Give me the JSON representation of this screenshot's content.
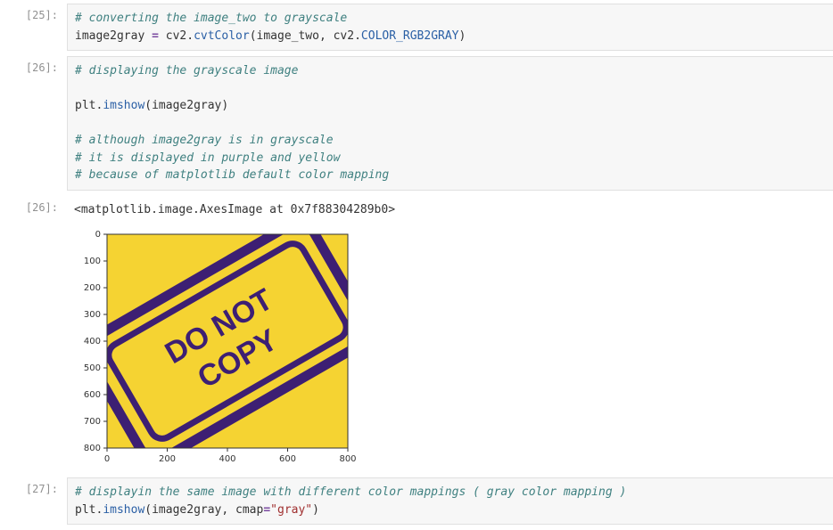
{
  "cells": {
    "c25": {
      "prompt": "[25]:",
      "code": {
        "l1_comment": "# converting the image_two to grayscale",
        "l2_var": "image2gray ",
        "l2_eq": "=",
        "l2_mod": " cv2",
        "l2_dot1": ".",
        "l2_fn": "cvtColor",
        "l2_paren1": "(image_two, cv2",
        "l2_dot2": ".",
        "l2_const": "COLOR_RGB2GRAY",
        "l2_paren2": ")"
      }
    },
    "c26in": {
      "prompt": "[26]:",
      "code": {
        "l1_comment": "# displaying the grayscale image",
        "blank1": "",
        "l2_obj": "plt",
        "l2_dot": ".",
        "l2_fn": "imshow",
        "l2_arg": "(image2gray)",
        "blank2": "",
        "l3_comment": "# although image2gray is in grayscale",
        "l4_comment": "# it is displayed in purple and yellow",
        "l5_comment": "# because of matplotlib default color mapping"
      }
    },
    "c26out": {
      "prompt": "[26]:",
      "text": "<matplotlib.image.AxesImage at 0x7f88304289b0>"
    },
    "c27": {
      "prompt": "[27]:",
      "code": {
        "l1_comment": "# displayin the same image with different color mappings ( gray color mapping )",
        "l2_obj": "plt",
        "l2_dot": ".",
        "l2_fn": "imshow",
        "l2_arg1": "(image2gray, cmap",
        "l2_eq": "=",
        "l2_str": "\"gray\"",
        "l2_arg2": ")"
      }
    }
  },
  "chart_data": {
    "type": "heatmap",
    "xlim": [
      0,
      800
    ],
    "ylim": [
      0,
      800
    ],
    "xticks": [
      0,
      200,
      400,
      600,
      800
    ],
    "yticks": [
      0,
      100,
      200,
      300,
      400,
      500,
      600,
      700,
      800
    ],
    "y_inverted": true,
    "colormap": "viridis",
    "content": "rotated-rectangle-stamp",
    "stamp": {
      "line1": "DO NOT",
      "line2": "COPY",
      "border_color": "#3d1f73",
      "fill_color": "#f5d332",
      "rotation_deg": -30
    }
  }
}
